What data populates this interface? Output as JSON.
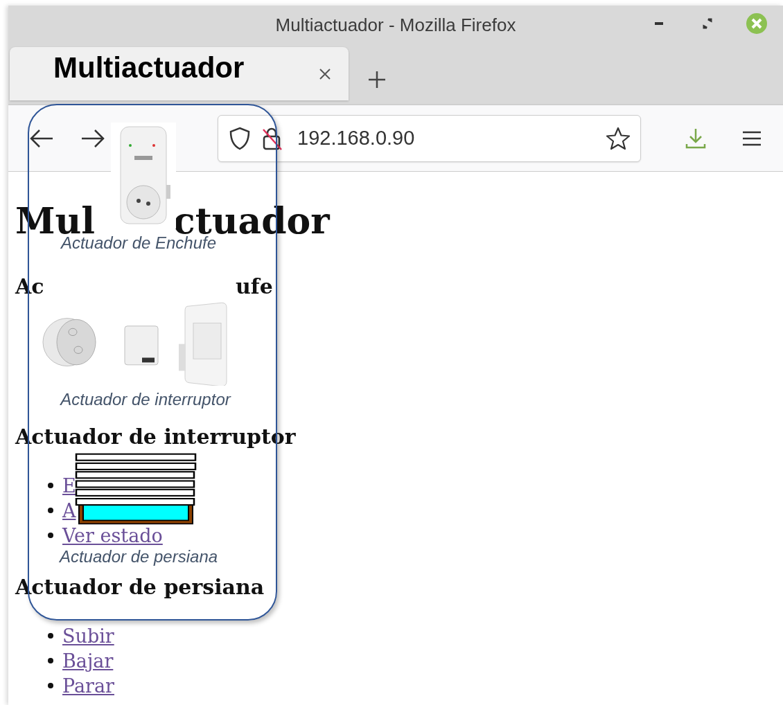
{
  "window": {
    "title": "Multiactuador - Mozilla Firefox"
  },
  "address_bar": {
    "url": "192.168.0.90"
  },
  "page": {
    "heading_parts": [
      "Mul",
      "ctuador"
    ],
    "sections": [
      {
        "heading_parts": [
          "Ac",
          "ufe"
        ]
      },
      {
        "heading_parts": [
          "Actuador de interruptor"
        ],
        "links": [
          "E",
          "A",
          "Ver estado"
        ]
      },
      {
        "heading_parts": [
          "Actuador de persiana"
        ],
        "links": [
          "Subir",
          "Bajar",
          "Parar"
        ]
      }
    ]
  },
  "overlay": {
    "title": "Multiactuador",
    "items": [
      {
        "kind": "plug",
        "caption": "Actuador de Enchufe"
      },
      {
        "kind": "switch",
        "caption": "Actuador de interruptor"
      },
      {
        "kind": "blind",
        "caption": "Actuador de persiana"
      }
    ]
  }
}
